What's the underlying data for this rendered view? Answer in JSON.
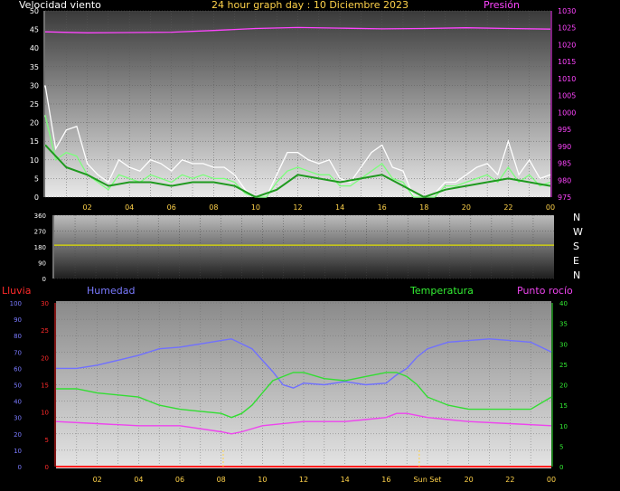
{
  "chart_data": [
    {
      "type": "line",
      "title": "24 hour graph day : 10 Diciembre 2023",
      "left_axis_label": "Velocidad viento",
      "right_axis_label": "Presión",
      "x_ticks": [
        "02",
        "04",
        "06",
        "08",
        "10",
        "12",
        "14",
        "16",
        "18",
        "20",
        "22",
        "00"
      ],
      "ylim_left": [
        0,
        50
      ],
      "y_ticks_left": [
        0,
        5,
        10,
        15,
        20,
        25,
        30,
        35,
        40,
        45,
        50
      ],
      "ylim_right": [
        975,
        1030
      ],
      "y_ticks_right": [
        975,
        980,
        985,
        990,
        995,
        1000,
        1005,
        1010,
        1015,
        1020,
        1025,
        1030
      ],
      "series": [
        {
          "color": "#ffffff",
          "axis": "left",
          "hours": [
            0,
            0.5,
            1,
            1.5,
            2,
            2.5,
            3,
            3.5,
            4,
            4.5,
            5,
            5.5,
            6,
            6.5,
            7,
            7.5,
            8,
            8.5,
            9,
            9.5,
            10,
            10.5,
            11,
            11.5,
            12,
            12.5,
            13,
            13.5,
            14,
            14.5,
            15,
            15.5,
            16,
            16.5,
            17,
            17.5,
            18,
            18.5,
            19,
            19.5,
            20,
            20.5,
            21,
            21.5,
            22,
            22.5,
            23,
            23.5,
            24
          ],
          "values": [
            30,
            13,
            18,
            19,
            9,
            6,
            4,
            10,
            8,
            7,
            10,
            9,
            7,
            10,
            9,
            9,
            8,
            8,
            6,
            2,
            0,
            0,
            6,
            12,
            12,
            10,
            9,
            10,
            5,
            4,
            8,
            12,
            14,
            8,
            7,
            0,
            0,
            1,
            4,
            4,
            6,
            8,
            9,
            6,
            15,
            6,
            10,
            5,
            6
          ]
        },
        {
          "color": "#7cff7c",
          "axis": "left",
          "hours": [
            0,
            0.5,
            1,
            1.5,
            2,
            2.5,
            3,
            3.5,
            4,
            4.5,
            5,
            5.5,
            6,
            6.5,
            7,
            7.5,
            8,
            8.5,
            9,
            9.5,
            10,
            10.5,
            11,
            11.5,
            12,
            12.5,
            13,
            13.5,
            14,
            14.5,
            15,
            15.5,
            16,
            16.5,
            17,
            17.5,
            18,
            18.5,
            19,
            19.5,
            20,
            20.5,
            21,
            21.5,
            22,
            22.5,
            23,
            23.5,
            24
          ],
          "values": [
            22,
            10,
            12,
            11,
            6,
            4,
            2,
            6,
            5,
            4,
            6,
            5,
            4,
            6,
            5,
            6,
            5,
            5,
            4,
            1,
            0,
            0,
            4,
            7,
            8,
            7,
            6,
            6,
            3,
            3,
            5,
            7,
            9,
            5,
            4,
            0,
            0,
            0,
            3,
            3,
            4,
            5,
            6,
            4,
            8,
            4,
            6,
            3,
            4
          ]
        },
        {
          "color": "#1f9a1f",
          "axis": "left",
          "hours": [
            0,
            1,
            2,
            3,
            4,
            5,
            6,
            7,
            8,
            9,
            10,
            11,
            12,
            13,
            14,
            15,
            16,
            17,
            18,
            19,
            20,
            21,
            22,
            23,
            24
          ],
          "values": [
            14,
            8,
            6,
            3,
            4,
            4,
            3,
            4,
            4,
            3,
            0,
            2,
            6,
            5,
            4,
            5,
            6,
            3,
            0,
            2,
            3,
            4,
            5,
            4,
            3
          ]
        },
        {
          "color": "#ff44ff",
          "axis": "right",
          "hours": [
            0,
            2,
            4,
            6,
            8,
            10,
            12,
            14,
            16,
            18,
            20,
            22,
            24
          ],
          "values": [
            1023.8,
            1023.5,
            1023.6,
            1023.7,
            1024.2,
            1024.8,
            1025.1,
            1024.9,
            1024.7,
            1024.8,
            1025.0,
            1024.8,
            1024.6
          ]
        }
      ]
    },
    {
      "type": "line",
      "ylim": [
        0,
        360
      ],
      "y_ticks": [
        0,
        90,
        180,
        270,
        360
      ],
      "compass_labels": [
        "N",
        "W",
        "S",
        "E",
        "N"
      ],
      "series": [
        {
          "color": "#e0e000",
          "hours": [
            0,
            24
          ],
          "values": [
            190,
            190
          ]
        }
      ]
    },
    {
      "type": "line",
      "left_outer_label": "Lluvia",
      "left_inner_label": "Humedad",
      "right_labels": [
        "Temperatura",
        "Punto rocío"
      ],
      "x_ticks": [
        "02",
        "04",
        "06",
        "08",
        "10",
        "12",
        "14",
        "16",
        "Sun Set",
        "20",
        "22",
        "00"
      ],
      "ylim_humidity": [
        0,
        100
      ],
      "y_ticks_humidity": [
        0,
        10,
        20,
        30,
        40,
        50,
        60,
        70,
        80,
        90,
        100
      ],
      "ylim_rain": [
        0,
        30
      ],
      "y_ticks_rain": [
        0,
        5,
        10,
        15,
        20,
        25,
        30
      ],
      "ylim_temp": [
        0,
        40
      ],
      "y_ticks_temp": [
        0,
        5,
        10,
        15,
        20,
        25,
        30,
        35,
        40
      ],
      "markers_hours": [
        8.1,
        17.6
      ],
      "series": [
        {
          "color": "#7070ff",
          "axis": "humidity",
          "hours": [
            0,
            1,
            2,
            3,
            4,
            5,
            6,
            7,
            8,
            8.5,
            9,
            9.5,
            10,
            10.5,
            11,
            11.5,
            12,
            13,
            14,
            15,
            16,
            16.5,
            17,
            17.5,
            18,
            19,
            20,
            21,
            22,
            23,
            24
          ],
          "values": [
            60,
            60,
            62,
            65,
            68,
            72,
            73,
            75,
            77,
            78,
            75,
            72,
            65,
            58,
            50,
            48,
            51,
            50,
            52,
            50,
            51,
            56,
            60,
            67,
            72,
            76,
            77,
            78,
            77,
            76,
            70
          ]
        },
        {
          "color": "#33dd33",
          "axis": "temp",
          "hours": [
            0,
            1,
            2,
            3,
            4,
            5,
            6,
            7,
            8,
            8.5,
            9,
            9.5,
            10,
            10.5,
            11,
            11.5,
            12,
            13,
            14,
            15,
            16,
            16.5,
            17,
            17.5,
            18,
            19,
            20,
            21,
            22,
            23,
            24
          ],
          "values": [
            19,
            19,
            18,
            17.5,
            17,
            15,
            14,
            13.5,
            13,
            12,
            13,
            15,
            18,
            21,
            22,
            23,
            23,
            21.5,
            21,
            22,
            23,
            23,
            22,
            20,
            17,
            15,
            14,
            14,
            14,
            14,
            17
          ]
        },
        {
          "color": "#ee44ee",
          "axis": "temp",
          "hours": [
            0,
            2,
            4,
            6,
            8,
            8.5,
            9,
            10,
            12,
            14,
            15,
            16,
            16.5,
            17,
            17.5,
            18,
            19,
            20,
            22,
            24
          ],
          "values": [
            11,
            10.5,
            10,
            10,
            8.5,
            8,
            8.5,
            10,
            11,
            11,
            11.5,
            12,
            13,
            13,
            12.5,
            12,
            11.5,
            11,
            10.5,
            10
          ]
        },
        {
          "color": "#ff2020",
          "axis": "rain",
          "hours": [
            0,
            24
          ],
          "values": [
            0,
            0
          ]
        }
      ]
    }
  ]
}
